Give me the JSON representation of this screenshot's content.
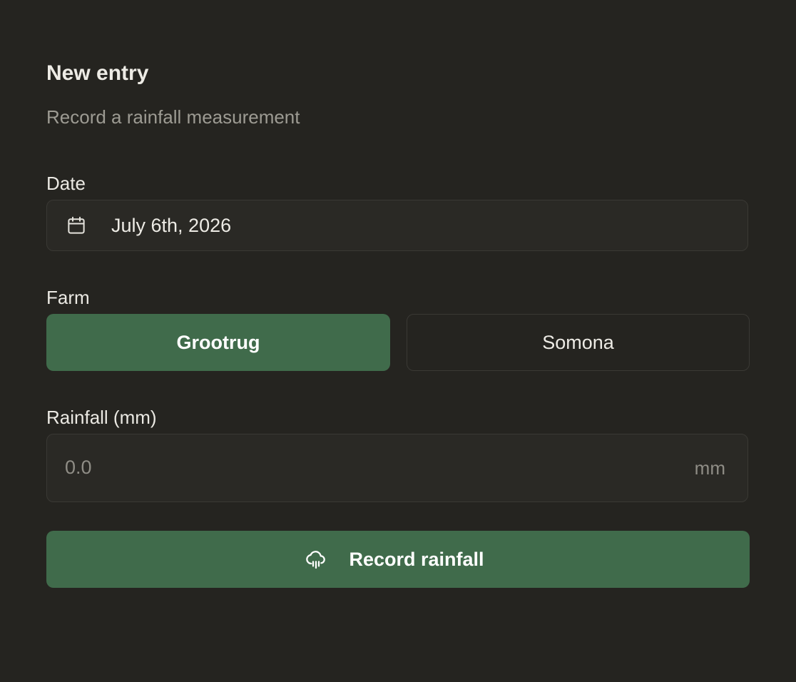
{
  "form": {
    "title": "New entry",
    "subtitle": "Record a rainfall measurement"
  },
  "date": {
    "label": "Date",
    "value": "July 6th, 2026",
    "icon": "calendar-icon"
  },
  "farm": {
    "label": "Farm",
    "options": [
      {
        "label": "Grootrug",
        "selected": true
      },
      {
        "label": "Somona",
        "selected": false
      }
    ]
  },
  "rainfall": {
    "label": "Rainfall (mm)",
    "value": "",
    "placeholder": "0.0",
    "unit": "mm"
  },
  "submit": {
    "label": "Record rainfall",
    "icon": "cloud-rain-icon"
  },
  "colors": {
    "background": "#252420",
    "accent": "#406b4b",
    "field_bg": "#2a2925",
    "border": "#3a3934",
    "muted_text": "#9d9b93"
  }
}
